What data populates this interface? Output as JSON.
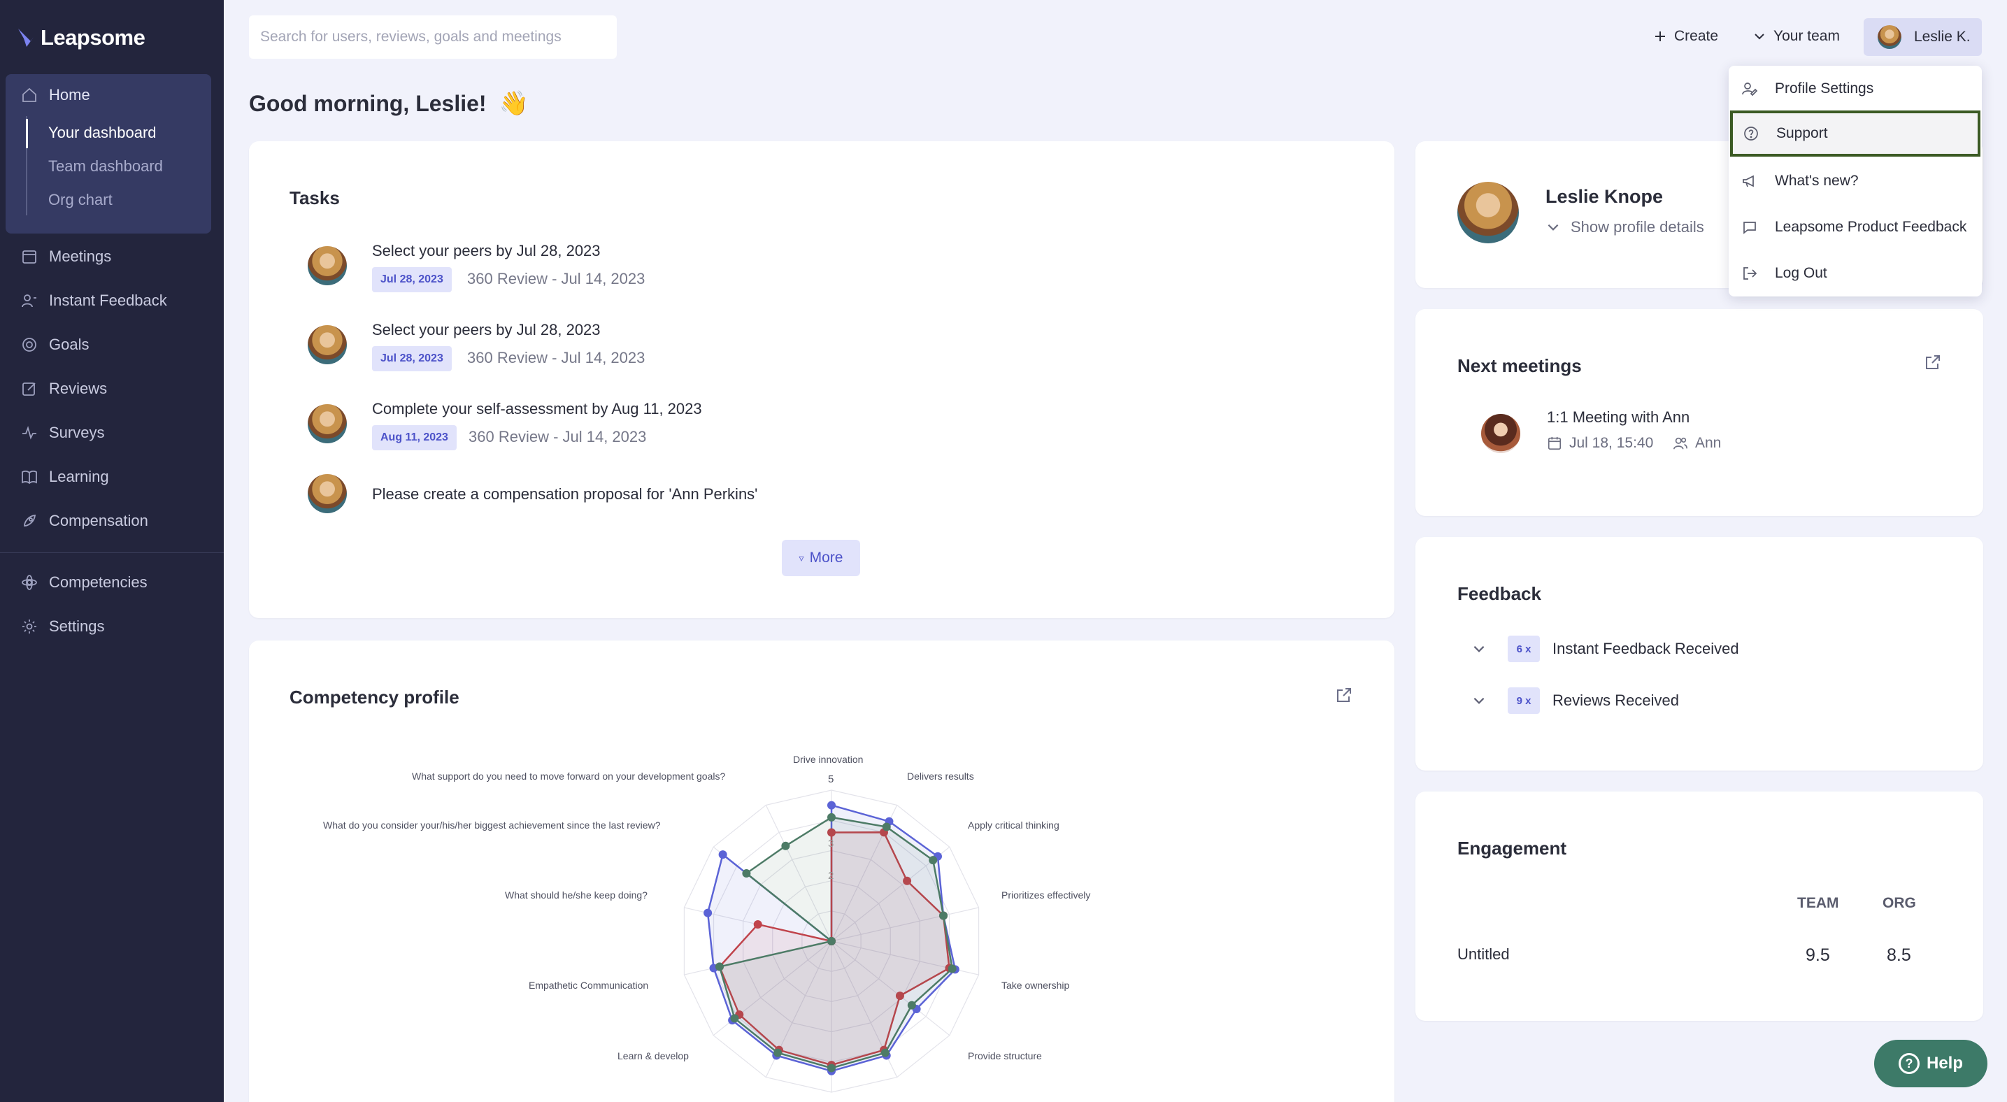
{
  "app": {
    "brand": "Leapsome"
  },
  "sidebar": {
    "home": "Home",
    "sub_items": [
      "Your dashboard",
      "Team dashboard",
      "Org chart"
    ],
    "items": [
      "Meetings",
      "Instant Feedback",
      "Goals",
      "Reviews",
      "Surveys",
      "Learning",
      "Compensation"
    ],
    "bottom_items": [
      "Competencies",
      "Settings"
    ]
  },
  "topbar": {
    "search_placeholder": "Search for users, reviews, goals and meetings",
    "create": "Create",
    "your_team": "Your team",
    "user": "Leslie K."
  },
  "greeting": {
    "text": "Good morning, Leslie!",
    "emoji": "👋"
  },
  "tasks": {
    "title": "Tasks",
    "items": [
      {
        "title": "Select your peers by Jul 28, 2023",
        "badge": "Jul 28, 2023",
        "sub": "360 Review - Jul 14, 2023"
      },
      {
        "title": "Select your peers by Jul 28, 2023",
        "badge": "Jul 28, 2023",
        "sub": "360 Review - Jul 14, 2023"
      },
      {
        "title": "Complete your self-assessment by Aug 11, 2023",
        "badge": "Aug 11, 2023",
        "sub": "360 Review - Jul 14, 2023"
      },
      {
        "title": "Please create a compensation proposal for 'Ann Perkins'",
        "badge": "",
        "sub": ""
      }
    ],
    "more": "More"
  },
  "competency": {
    "title": "Competency profile",
    "axis_labels": [
      "Drive innovation",
      "Delivers results",
      "Apply critical thinking",
      "Prioritizes effectively",
      "Take ownership",
      "Provide structure",
      "Learn & develop",
      "Empathetic Communication",
      "What should he/she keep doing?",
      "What do you consider your/his/her biggest achievement since the last review?",
      "What support do you need to move forward on your development goals?"
    ],
    "scale_labels": [
      "5",
      "3",
      "2"
    ]
  },
  "chart_data": {
    "type": "radar",
    "categories": [
      "Drive innovation",
      "Delivers results",
      "Apply critical thinking",
      "Prioritizes effectively",
      "Take ownership",
      "Provide structure",
      "(unlabeled)",
      "(unlabeled)",
      "(unlabeled)",
      "Learn & develop",
      "Empathetic Communication",
      "What should he/she keep doing?",
      "What do you consider your/his/her biggest achievement since the last review?",
      "What support do you need to move forward on your development goals?"
    ],
    "ylim": [
      0,
      5
    ],
    "series": [
      {
        "color": "#5b63d6",
        "values": [
          4.5,
          4.4,
          4.5,
          3.8,
          4.2,
          3.6,
          4.2,
          4.3,
          4.2,
          4.2,
          4.0,
          4.2,
          4.6,
          0
        ]
      },
      {
        "color": "#c0434b",
        "values": [
          3.6,
          4.0,
          3.2,
          3.8,
          4.0,
          2.9,
          4.0,
          4.1,
          4.0,
          3.9,
          3.8,
          2.5,
          0,
          0
        ]
      },
      {
        "color": "#4d7b66",
        "values": [
          4.1,
          4.2,
          4.3,
          3.8,
          4.1,
          3.4,
          4.1,
          4.2,
          4.1,
          4.1,
          3.8,
          0,
          3.6,
          3.5
        ]
      }
    ]
  },
  "profile": {
    "name": "Leslie Knope",
    "details": "Show profile details"
  },
  "meetings": {
    "title": "Next meetings",
    "item_title": "1:1 Meeting with Ann",
    "date": "Jul 18, 15:40",
    "person": "Ann"
  },
  "feedback": {
    "title": "Feedback",
    "rows": [
      {
        "count": "6 x",
        "label": "Instant Feedback Received"
      },
      {
        "count": "9 x",
        "label": "Reviews Received"
      }
    ]
  },
  "engagement": {
    "title": "Engagement",
    "team_label": "TEAM",
    "org_label": "ORG",
    "row_label": "Untitled",
    "team_value": "9.5",
    "org_value": "8.5"
  },
  "dropdown": {
    "items": [
      "Profile Settings",
      "Support",
      "What's new?",
      "Leapsome Product Feedback",
      "Log Out"
    ]
  },
  "help": {
    "label": "Help"
  }
}
